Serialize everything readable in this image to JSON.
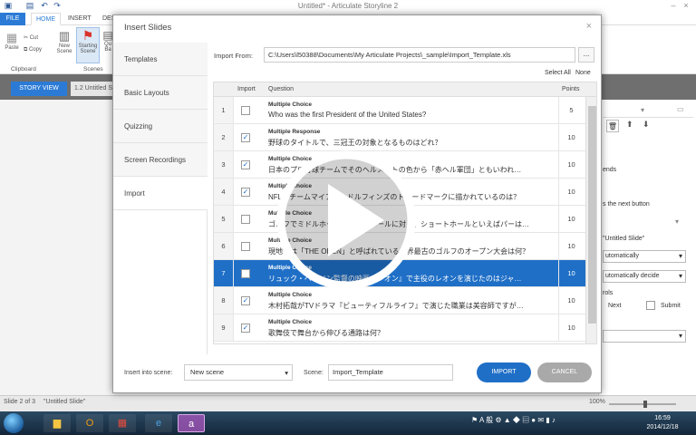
{
  "window": {
    "title": "Untitled* - Articulate Storyline 2"
  },
  "ribbon": {
    "tabs": [
      "FILE",
      "HOME",
      "INSERT",
      "DES"
    ],
    "buttons": {
      "paste": "Paste",
      "cut": "Cut",
      "copy": "Copy",
      "new_scene": "New Scene",
      "starting_scene": "Starting Scene",
      "question_bank": "Qu Ba"
    },
    "groups": {
      "clipboard": "Clipboard",
      "scenes": "Scenes"
    }
  },
  "storyview": {
    "story_view_label": "STORY VIEW",
    "slide_tab": "1.2 Untitled S"
  },
  "right_panel": {
    "text1": "ends",
    "text2": "s the next button",
    "untitled_slide": "\"Untitled Slide\"",
    "select1": "utomatically",
    "select2": "utomatically decide",
    "rols": "rols",
    "next": "Next",
    "submit": "Submit"
  },
  "statusbar": {
    "slide_info": "Slide 2 of 3",
    "slide_name": "\"Untitled Slide\"",
    "zoom": "100%"
  },
  "dialog": {
    "title": "Insert Slides",
    "close": "×",
    "nav": [
      "Templates",
      "Basic Layouts",
      "Quizzing",
      "Screen Recordings",
      "Import"
    ],
    "import_from_label": "Import From:",
    "import_path": "C:\\Users\\l50388\\Documents\\My Articulate Projects\\_sample\\Import_Template.xls",
    "browse": "...",
    "select_all": "Select All",
    "select_none": "None",
    "columns": {
      "import": "Import",
      "question": "Question",
      "points": "Points"
    },
    "rows": [
      {
        "num": "1",
        "type": "Multiple Choice",
        "text": "Who was the first President of the United States?",
        "points": "5"
      },
      {
        "num": "2",
        "type": "Multiple Response",
        "text": "野球のタイトルで、三冠王の対象となるものはどれ？",
        "points": "10"
      },
      {
        "num": "3",
        "type": "Multiple Choice",
        "text": "日本のプロ野球チームでそのヘルメットの色から「赤ヘル軍団」ともいわれ…",
        "points": "10"
      },
      {
        "num": "4",
        "type": "Multiple Choice",
        "text": "NFLのチームマイアミ・ドルフィンズのトレードマークに描かれているのは？",
        "points": "10"
      },
      {
        "num": "5",
        "type": "Multiple Choice",
        "text": "ゴルフでミドルホール、ロングホールに対し、ショートホールといえばパーは…",
        "points": "10"
      },
      {
        "num": "6",
        "type": "Multiple Choice",
        "text": "現地では「THE OPEN」と呼ばれている世界最古のゴルフのオープン大会は何？",
        "points": "10"
      },
      {
        "num": "7",
        "type": "Multiple Choice",
        "text": "リュック・ベッソン監督の映画『レオン』で主役のレオンを演じたのはジャ…",
        "points": "10"
      },
      {
        "num": "8",
        "type": "Multiple Choice",
        "text": "木村拓哉がTVドラマ『ビューティフルライフ』で演じた職業は美容師ですが…",
        "points": "10"
      },
      {
        "num": "9",
        "type": "Multiple Choice",
        "text": "歌舞伎で舞台から伸びる通路は何？",
        "points": "10"
      }
    ],
    "insert_into_scene_label": "Insert into scene:",
    "scene_select_value": "New scene",
    "scene_label": "Scene:",
    "scene_name": "Import_Template",
    "import_button": "IMPORT",
    "cancel_button": "CANCEL"
  },
  "taskbar": {
    "time": "16:59",
    "date": "2014/12/18",
    "tray_text": "A 般"
  },
  "colors": {
    "accent": "#1f6fc7",
    "file_tab": "#2b7bd6",
    "taskbar": "#1d3650"
  }
}
